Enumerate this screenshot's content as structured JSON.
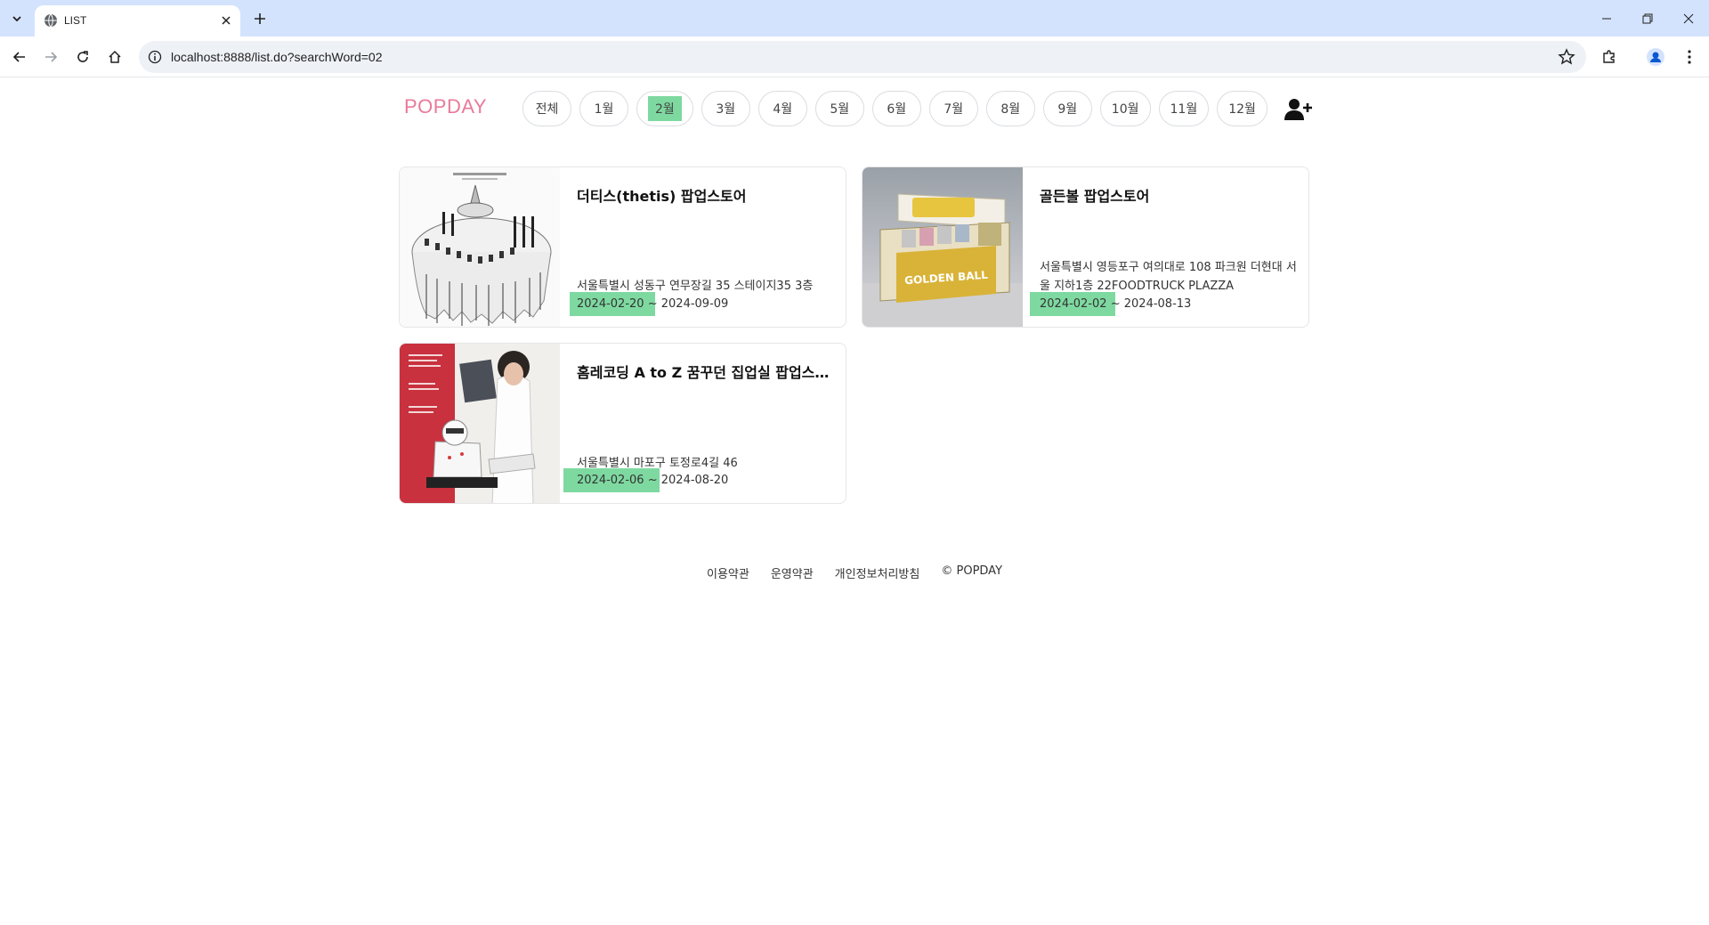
{
  "browser": {
    "tab_title": "LIST",
    "url": "localhost:8888/list.do?searchWord=02",
    "tab_menu_icon": "chevron-down-icon",
    "new_tab_icon": "plus-icon"
  },
  "site": {
    "logo": "POPDAY",
    "add_user_icon": "add-user-icon"
  },
  "months": [
    {
      "label": "전체",
      "active": false
    },
    {
      "label": "1월",
      "active": false
    },
    {
      "label": "2월",
      "active": true
    },
    {
      "label": "3월",
      "active": false
    },
    {
      "label": "4월",
      "active": false
    },
    {
      "label": "5월",
      "active": false
    },
    {
      "label": "6월",
      "active": false
    },
    {
      "label": "7월",
      "active": false
    },
    {
      "label": "8월",
      "active": false
    },
    {
      "label": "9월",
      "active": false
    },
    {
      "label": "10월",
      "active": false
    },
    {
      "label": "11월",
      "active": false
    },
    {
      "label": "12월",
      "active": false
    }
  ],
  "cards": [
    {
      "title": "더티스(thetis) 팝업스토어",
      "address": "서울특별시 성동구 연무장길 35 스테이지35 3층",
      "start_date": "2024-02-20",
      "end_date": "2024-09-09"
    },
    {
      "title": "골든볼 팝업스토어",
      "address": "서울특별시 영등포구 여의대로 108 파크원 더현대 서울 지하1층 22FOODTRUCK PLAZZA",
      "start_date": "2024-02-02",
      "end_date": "2024-08-13",
      "image_text": "GOLDEN BALL"
    },
    {
      "title": "홈레코딩 A to Z 꿈꾸던 집업실 팝업스토어",
      "address": "서울특별시 마포구 토정로4길 46",
      "start_date": "2024-02-06",
      "end_date": "2024-08-20"
    }
  ],
  "date_separator": "~",
  "footer": {
    "terms": "이용약관",
    "operation": "운영약관",
    "privacy": "개인정보처리방침",
    "copyright": "© POPDAY"
  },
  "colors": {
    "highlight": "#7ed9a0",
    "logo": "#e97a9a",
    "chrome_tabbar": "#d3e3fd"
  }
}
